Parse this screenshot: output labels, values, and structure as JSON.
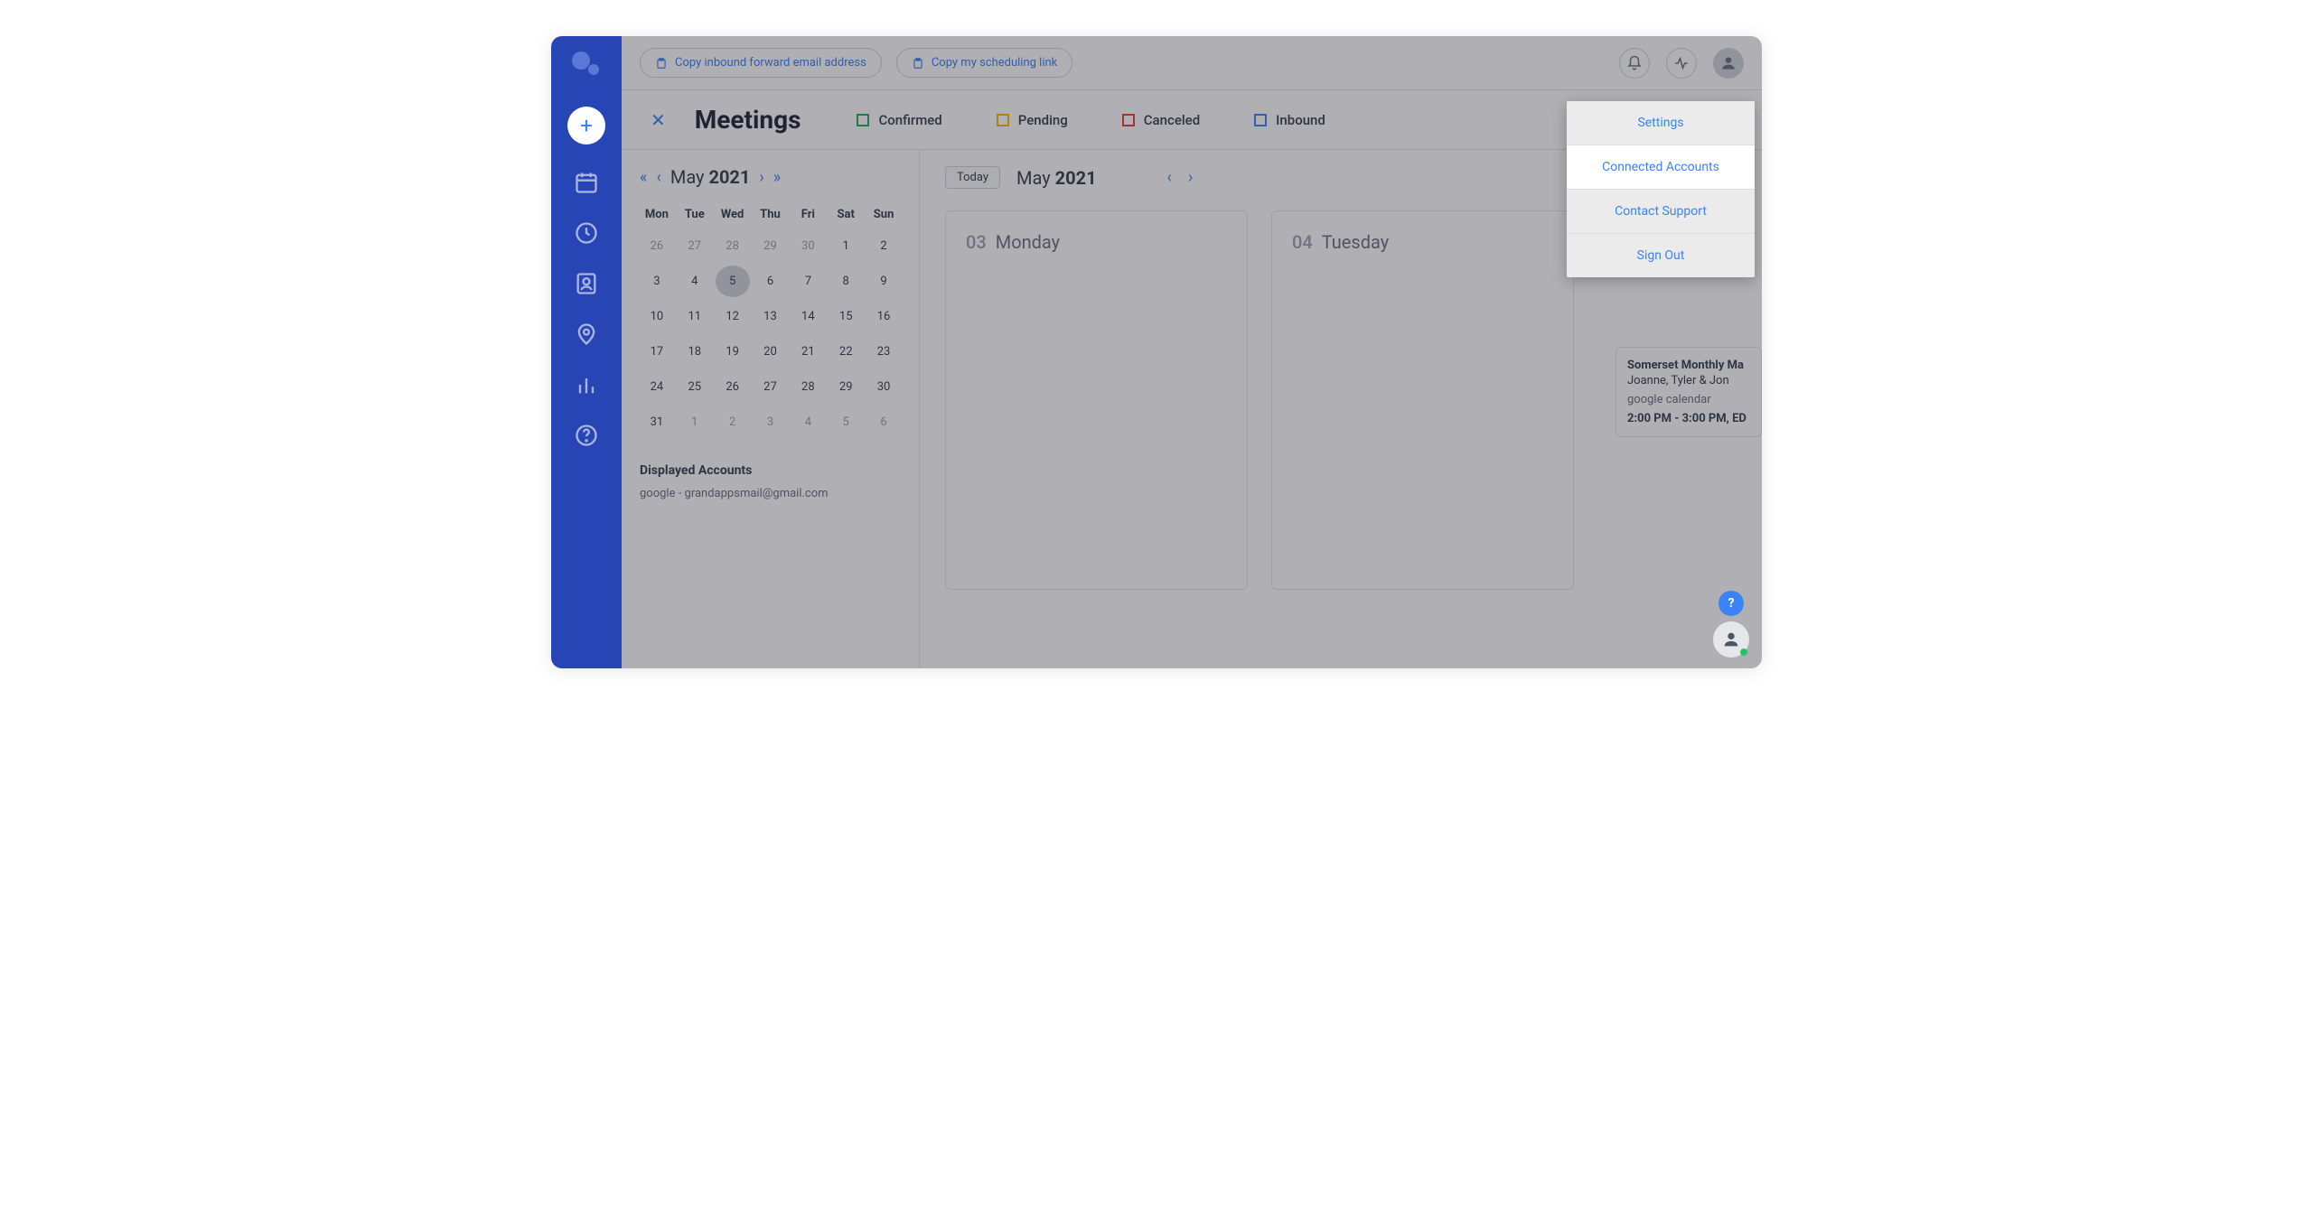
{
  "topbar": {
    "copy_inbound_label": "Copy inbound forward email address",
    "copy_scheduling_label": "Copy my scheduling link"
  },
  "header": {
    "title": "Meetings",
    "statuses": [
      {
        "label": "Confirmed",
        "color": "#34a853"
      },
      {
        "label": "Pending",
        "color": "#fbbc05"
      },
      {
        "label": "Canceled",
        "color": "#ea4335"
      },
      {
        "label": "Inbound",
        "color": "#4285f4"
      }
    ]
  },
  "mini_cal": {
    "month": "May",
    "year": "2021",
    "dow": [
      "Mon",
      "Tue",
      "Wed",
      "Thu",
      "Fri",
      "Sat",
      "Sun"
    ],
    "days": [
      {
        "n": "26",
        "m": true
      },
      {
        "n": "27",
        "m": true
      },
      {
        "n": "28",
        "m": true
      },
      {
        "n": "29",
        "m": true
      },
      {
        "n": "30",
        "m": true
      },
      {
        "n": "1"
      },
      {
        "n": "2"
      },
      {
        "n": "3"
      },
      {
        "n": "4"
      },
      {
        "n": "5",
        "sel": true
      },
      {
        "n": "6"
      },
      {
        "n": "7"
      },
      {
        "n": "8"
      },
      {
        "n": "9"
      },
      {
        "n": "10"
      },
      {
        "n": "11"
      },
      {
        "n": "12"
      },
      {
        "n": "13"
      },
      {
        "n": "14"
      },
      {
        "n": "15"
      },
      {
        "n": "16"
      },
      {
        "n": "17"
      },
      {
        "n": "18"
      },
      {
        "n": "19"
      },
      {
        "n": "20"
      },
      {
        "n": "21"
      },
      {
        "n": "22"
      },
      {
        "n": "23"
      },
      {
        "n": "24"
      },
      {
        "n": "25"
      },
      {
        "n": "26"
      },
      {
        "n": "27"
      },
      {
        "n": "28"
      },
      {
        "n": "29"
      },
      {
        "n": "30"
      },
      {
        "n": "31"
      },
      {
        "n": "1",
        "m": true
      },
      {
        "n": "2",
        "m": true
      },
      {
        "n": "3",
        "m": true
      },
      {
        "n": "4",
        "m": true
      },
      {
        "n": "5",
        "m": true
      },
      {
        "n": "6",
        "m": true
      }
    ],
    "accounts_title": "Displayed Accounts",
    "accounts_item": "google - grandappsmail@gmail.com"
  },
  "center": {
    "today_label": "Today",
    "month": "May",
    "year": "2021",
    "days": [
      {
        "num": "03",
        "name": "Monday"
      },
      {
        "num": "04",
        "name": "Tuesday"
      }
    ]
  },
  "event": {
    "title": "Somerset Monthly Ma",
    "sub": "Joanne, Tyler & Jon",
    "source": "google calendar",
    "time": "2:00 PM - 3:00 PM, ED"
  },
  "dropdown": {
    "items": [
      "Settings",
      "Connected Accounts",
      "Contact Support",
      "Sign Out"
    ],
    "active_index": 1
  },
  "help_fab": "?"
}
